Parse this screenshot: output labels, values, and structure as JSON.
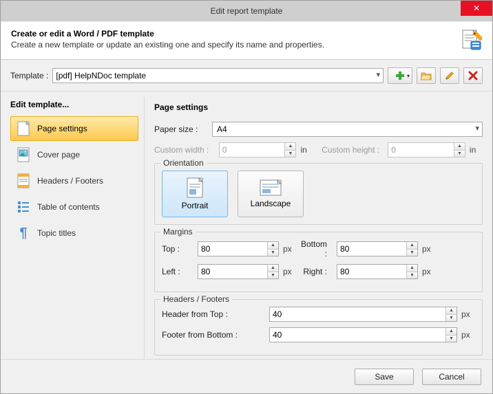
{
  "window": {
    "title": "Edit report template"
  },
  "header": {
    "title": "Create or edit a Word / PDF template",
    "subtitle": "Create a new template or update an existing one and specify its name and properties."
  },
  "template": {
    "label": "Template :",
    "selected": "[pdf] HelpNDoc template"
  },
  "sidebar": {
    "title": "Edit template...",
    "items": [
      {
        "label": "Page settings",
        "icon": "page-icon"
      },
      {
        "label": "Cover page",
        "icon": "image-page-icon"
      },
      {
        "label": "Headers / Footers",
        "icon": "hf-icon"
      },
      {
        "label": "Table of contents",
        "icon": "toc-icon"
      },
      {
        "label": "Topic titles",
        "icon": "pilcrow-icon"
      }
    ]
  },
  "page_settings": {
    "title": "Page settings",
    "paper_size": {
      "label": "Paper size :",
      "value": "A4"
    },
    "custom_width": {
      "label": "Custom width :",
      "value": "0",
      "unit": "in"
    },
    "custom_height": {
      "label": "Custom height :",
      "value": "0",
      "unit": "in"
    },
    "orientation": {
      "legend": "Orientation",
      "portrait": "Portrait",
      "landscape": "Landscape",
      "selected": "portrait"
    },
    "margins": {
      "legend": "Margins",
      "top": {
        "label": "Top :",
        "value": "80",
        "unit": "px"
      },
      "bottom": {
        "label": "Bottom :",
        "value": "80",
        "unit": "px"
      },
      "left": {
        "label": "Left :",
        "value": "80",
        "unit": "px"
      },
      "right": {
        "label": "Right :",
        "value": "80",
        "unit": "px"
      }
    },
    "headers_footers": {
      "legend": "Headers / Footers",
      "header_top": {
        "label": "Header from Top :",
        "value": "40",
        "unit": "px"
      },
      "footer_bottom": {
        "label": "Footer from Bottom :",
        "value": "40",
        "unit": "px"
      }
    }
  },
  "footer": {
    "save": "Save",
    "cancel": "Cancel"
  },
  "icons": {
    "new": "new-icon",
    "open": "open-folder-icon",
    "edit": "pencil-icon",
    "delete": "delete-icon"
  }
}
